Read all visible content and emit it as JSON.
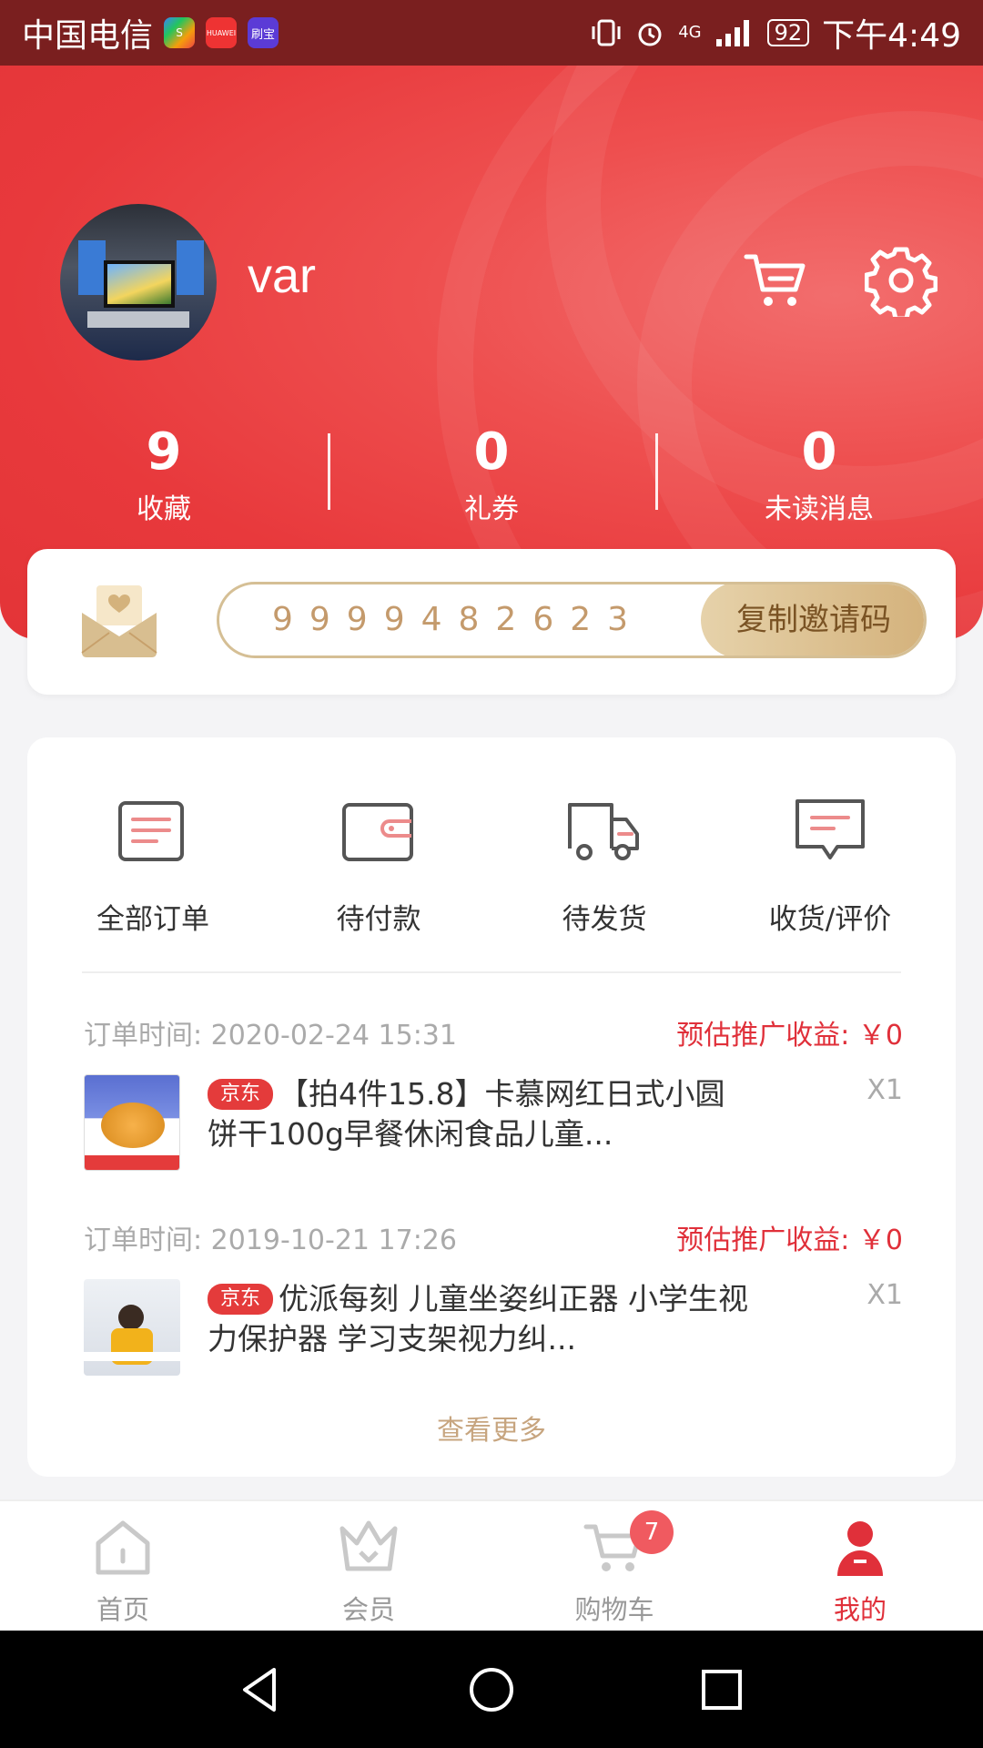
{
  "status_bar": {
    "carrier": "中国电信",
    "apps": [
      "S",
      "HUAWEI",
      "刷宝"
    ],
    "network": "4G",
    "battery": "92",
    "time": "下午4:49"
  },
  "profile": {
    "username": "var"
  },
  "stats": [
    {
      "value": "9",
      "label": "收藏"
    },
    {
      "value": "0",
      "label": "礼券"
    },
    {
      "value": "0",
      "label": "未读消息"
    }
  ],
  "invite": {
    "code": "9999482623",
    "copy_label": "复制邀请码"
  },
  "order_tabs": [
    {
      "label": "全部订单",
      "icon": "order-list-icon"
    },
    {
      "label": "待付款",
      "icon": "wallet-icon"
    },
    {
      "label": "待发货",
      "icon": "truck-icon"
    },
    {
      "label": "收货/评价",
      "icon": "comment-icon"
    }
  ],
  "orders": [
    {
      "time": "订单时间: 2020-02-24 15:31",
      "earnings": "预估推广收益: ￥0",
      "tag": "京东",
      "title": "【拍4件15.8】卡慕网红日式小圆饼干100g早餐休闲食品儿童...",
      "qty": "X1"
    },
    {
      "time": "订单时间: 2019-10-21 17:26",
      "earnings": "预估推广收益: ￥0",
      "tag": "京东",
      "title": "优派每刻 儿童坐姿纠正器 小学生视力保护器 学习支架视力纠...",
      "qty": "X1"
    }
  ],
  "more_label": "查看更多",
  "bottom_nav": [
    {
      "label": "首页",
      "icon": "home-icon"
    },
    {
      "label": "会员",
      "icon": "crown-icon"
    },
    {
      "label": "购物车",
      "icon": "cart-icon",
      "badge": "7"
    },
    {
      "label": "我的",
      "icon": "profile-icon",
      "active": true
    }
  ],
  "colors": {
    "brand_red": "#e8393c",
    "gold": "#c49a6c",
    "earn_red": "#e0303a"
  }
}
